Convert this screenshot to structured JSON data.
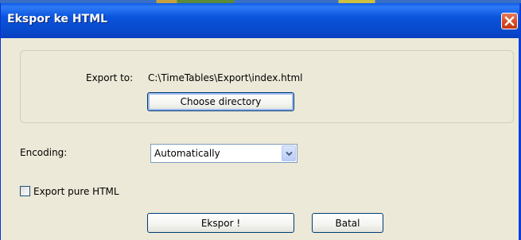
{
  "window": {
    "title": "Ekspor ke HTML"
  },
  "export": {
    "label": "Export to:",
    "path": "C:\\TimeTables\\Export\\index.html",
    "choose_label": "Choose directory"
  },
  "encoding": {
    "label": "Encoding:",
    "selected": "Automatically"
  },
  "options": {
    "pure_html_label": "Export pure HTML",
    "pure_html_checked": false
  },
  "buttons": {
    "ok_label": "Ekspor !",
    "cancel_label": "Batal"
  },
  "colors": {
    "titlebar": "#0a54dc",
    "close": "#d8481f",
    "dialog_bg": "#ece9d8"
  },
  "icons": {
    "close": "close-icon",
    "dropdown": "chevron-down-icon"
  }
}
